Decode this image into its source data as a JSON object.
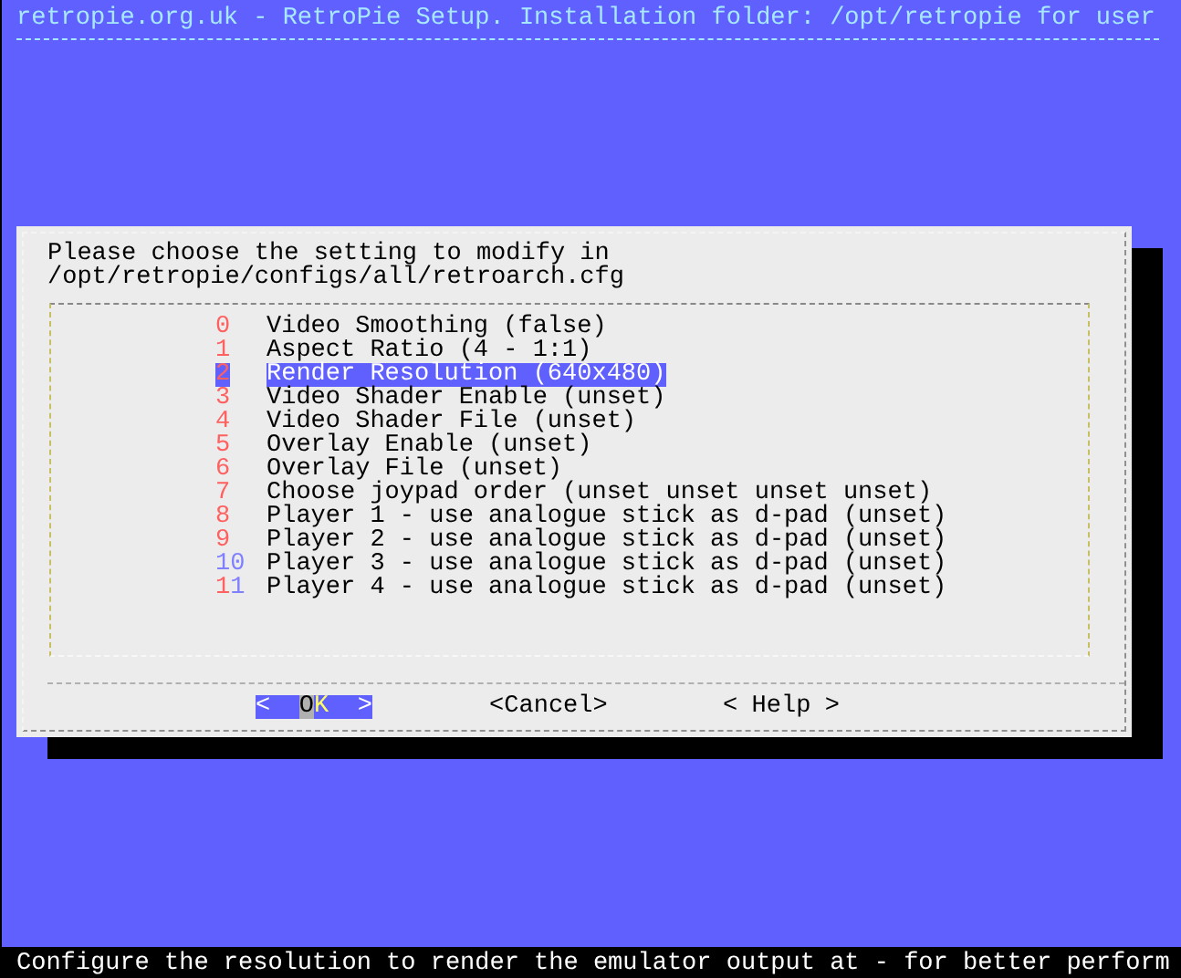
{
  "title": "retropie.org.uk - RetroPie Setup. Installation folder: /opt/retropie for user",
  "dialog": {
    "prompt_lines": [
      "Please choose the setting to modify in",
      "/opt/retropie/configs/all/retroarch.cfg"
    ],
    "items": [
      {
        "tag": "0",
        "hotkey": true,
        "label": "Video Smoothing (false)",
        "selected": false
      },
      {
        "tag": "1",
        "hotkey": true,
        "label": "Aspect Ratio (4 - 1:1)",
        "selected": false
      },
      {
        "tag": "2",
        "hotkey": true,
        "label": "Render Resolution (640x480)",
        "selected": true
      },
      {
        "tag": "3",
        "hotkey": true,
        "label": "Video Shader Enable (unset)",
        "selected": false
      },
      {
        "tag": "4",
        "hotkey": true,
        "label": "Video Shader File (unset)",
        "selected": false
      },
      {
        "tag": "5",
        "hotkey": true,
        "label": "Overlay Enable (unset)",
        "selected": false
      },
      {
        "tag": "6",
        "hotkey": true,
        "label": "Overlay File (unset)",
        "selected": false
      },
      {
        "tag": "7",
        "hotkey": true,
        "label": "Choose joypad order (unset unset unset unset)",
        "selected": false
      },
      {
        "tag": "8",
        "hotkey": true,
        "label": "Player 1 - use analogue stick as d-pad (unset)",
        "selected": false
      },
      {
        "tag": "9",
        "hotkey": true,
        "label": "Player 2 - use analogue stick as d-pad (unset)",
        "selected": false
      },
      {
        "tag": "10",
        "hotkey": false,
        "label": "Player 3 - use analogue stick as d-pad (unset)",
        "selected": false
      },
      {
        "tag": "11",
        "hotkey": true,
        "label": "Player 4 - use analogue stick as d-pad (unset)",
        "selected": false
      }
    ],
    "buttons": [
      {
        "open": "<",
        "label": "OK",
        "close": ">",
        "selected": true
      },
      {
        "open": "<",
        "label": "Cancel",
        "close": ">",
        "selected": false
      },
      {
        "open": "<",
        "label": "Help",
        "close": ">",
        "selected": false
      }
    ]
  },
  "status_bar": "Configure the resolution to render the emulator output at - for better perform"
}
